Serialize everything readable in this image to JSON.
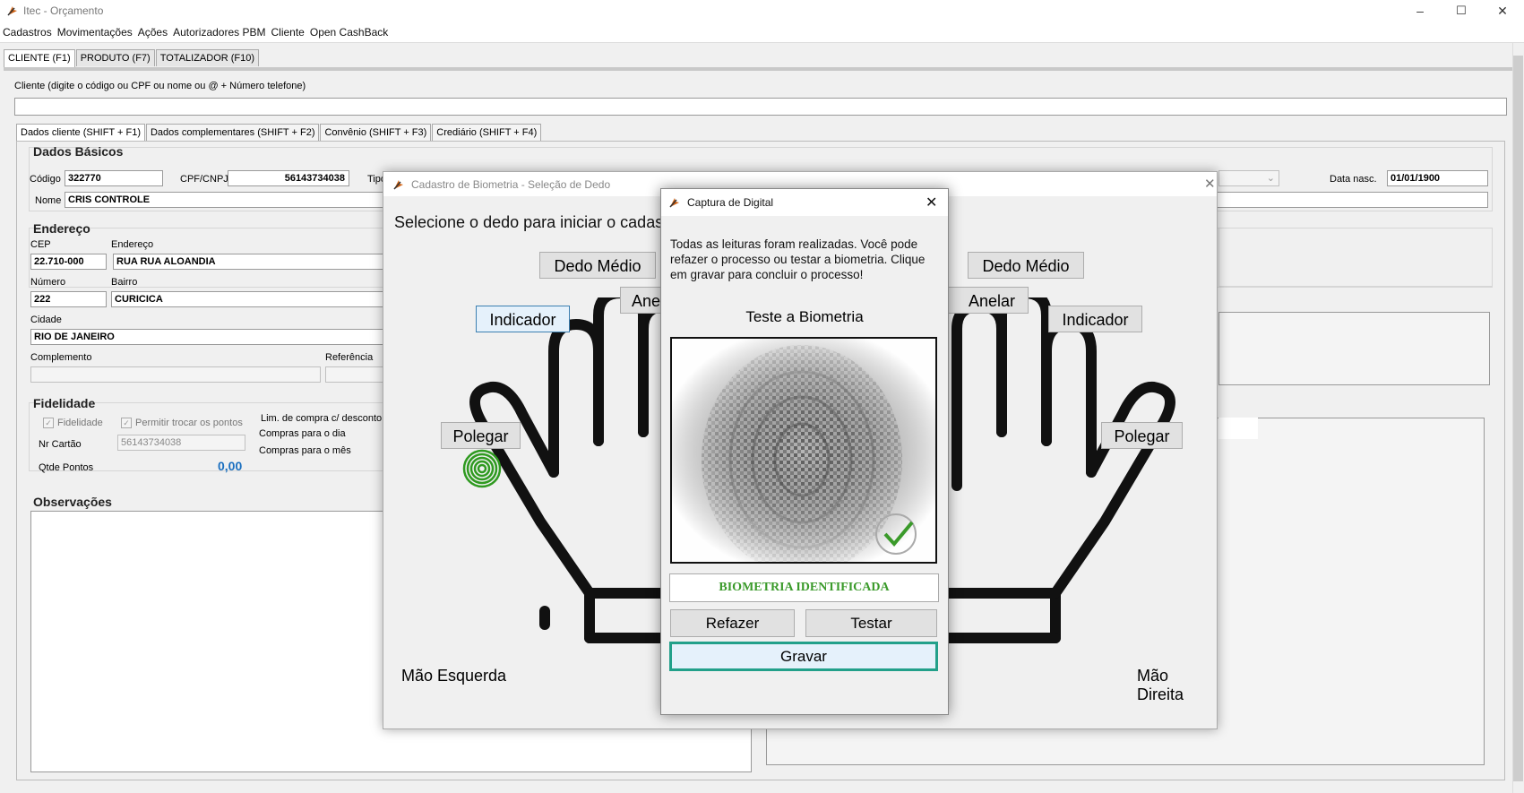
{
  "window": {
    "title": "Itec - Orçamento",
    "minimize": "–",
    "maximize": "☐",
    "close": "✕"
  },
  "menu": [
    "Cadastros",
    "Movimentações",
    "Ações",
    "Autorizadores PBM",
    "Cliente",
    "Open CashBack"
  ],
  "main_tabs": [
    "CLIENTE (F1)",
    "PRODUTO (F7)",
    "TOTALIZADOR (F10)"
  ],
  "cliente_search": {
    "label": "Cliente (digite o código ou CPF ou nome ou @ + Número telefone)",
    "value": ""
  },
  "sub_tabs": [
    "Dados cliente (SHIFT + F1)",
    "Dados complementares (SHIFT + F2)",
    "Convênio (SHIFT + F3)",
    "Crediário (SHIFT + F4)"
  ],
  "dados_basicos": {
    "title": "Dados Básicos",
    "codigo_label": "Código",
    "codigo": "322770",
    "cpf_label": "CPF/CNPJ",
    "cpf": "56143734038",
    "tipo_label": "Tipo",
    "nome_label": "Nome",
    "nome": "CRIS CONTROLE",
    "datanasc_label": "Data nasc.",
    "datanasc": "01/01/1900"
  },
  "endereco": {
    "title": "Endereço",
    "cep_label": "CEP",
    "cep": "22.710-000",
    "end_label": "Endereço",
    "end": "RUA RUA ALOANDIA",
    "num_label": "Número",
    "num": "222",
    "bairro_label": "Bairro",
    "bairro": "CURICICA",
    "cidade_label": "Cidade",
    "cidade": "RIO DE JANEIRO",
    "comp_label": "Complemento",
    "comp": "",
    "ref_label": "Referência",
    "ref": ""
  },
  "fidelidade": {
    "title": "Fidelidade",
    "chk1": "Fidelidade",
    "chk2": "Permitir trocar os pontos",
    "cartao_label": "Nr Cartão",
    "cartao": "56143734038",
    "pontos_label": "Qtde Pontos",
    "pontos": "0,00",
    "lim_label": "Lim. de compra c/ desconto",
    "dia_label": "Compras para o dia",
    "mes_label": "Compras para o mês"
  },
  "observacoes": {
    "title": "Observações"
  },
  "biometria": {
    "title": "Cadastro de Biometria - Seleção de Dedo",
    "instruction": "Selecione o dedo para iniciar o cadast",
    "left": {
      "medio": "Dedo Médio",
      "anelar": "Ane",
      "indicador": "Indicador",
      "polegar": "Polegar",
      "hand_label": "Mão Esquerda"
    },
    "right": {
      "medio": "Dedo Médio",
      "anelar": "Anelar",
      "indicador": "Indicador",
      "polegar": "Polegar",
      "hand_label": "Mão Direita"
    }
  },
  "captura": {
    "title": "Captura de Digital",
    "message": "Todas as leituras foram realizadas. Você pode refazer o processo ou testar a biometria. Clique em gravar para concluir o processo!",
    "test_title": "Teste a Biometria",
    "status": "BIOMETRIA IDENTIFICADA",
    "status_color": "#3a9a2a",
    "refazer": "Refazer",
    "testar": "Testar",
    "gravar": "Gravar"
  }
}
